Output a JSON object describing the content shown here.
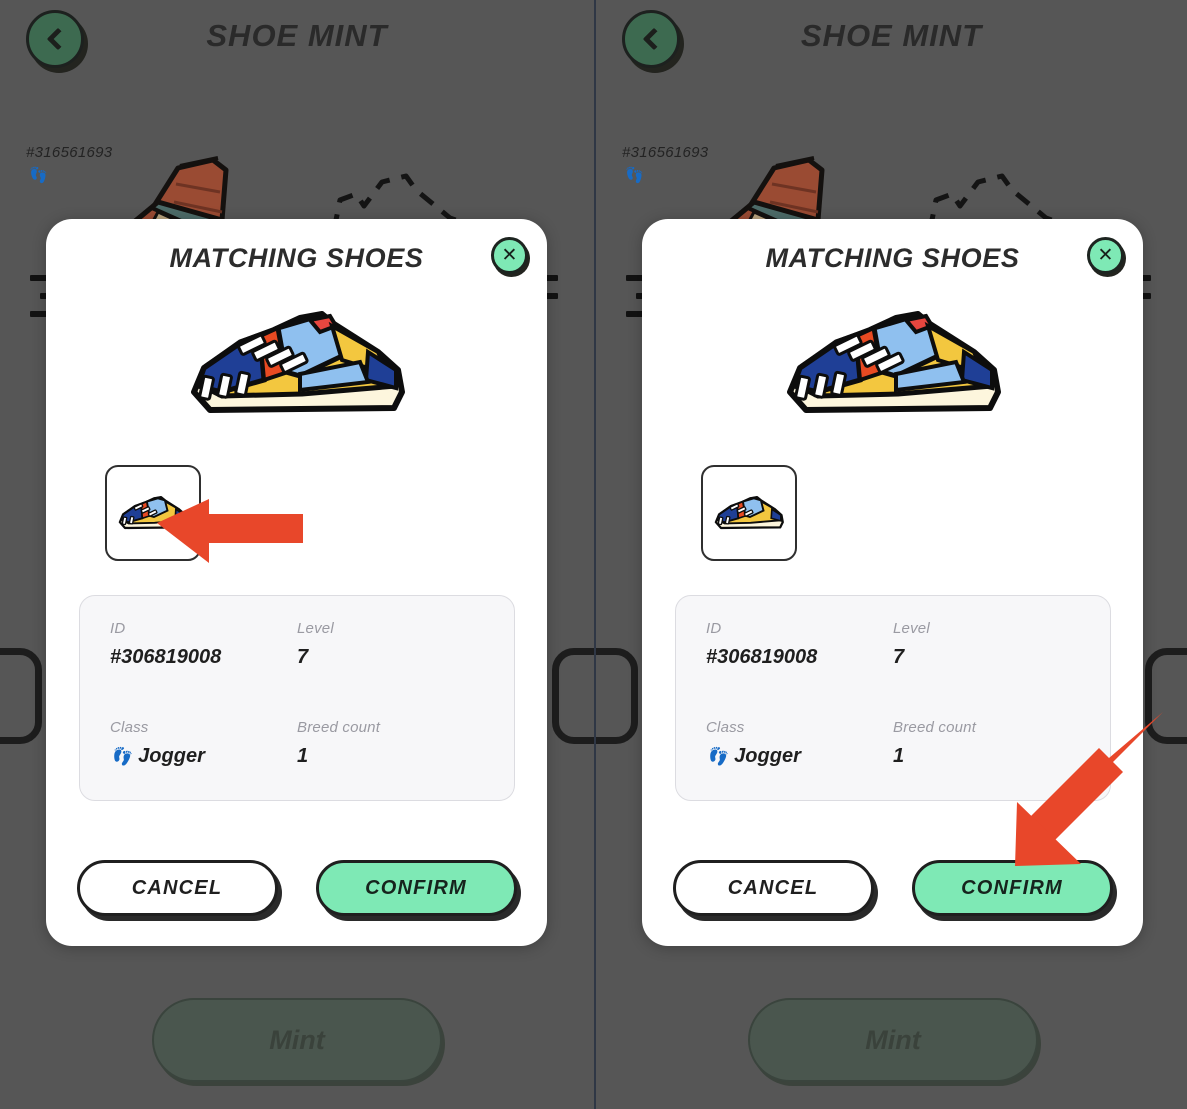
{
  "app": {
    "title": "SHOE MINT",
    "back_icon": "chevron-left-icon",
    "slot_id": "#316561693",
    "footprint_icon": "footprint-icon",
    "mint_button": "Mint"
  },
  "modal": {
    "title": "MATCHING SHOES",
    "close_icon": "close-icon",
    "close_label": "✕",
    "shoe_icon": "sneaker-icon",
    "thumbnail_icon": "sneaker-thumbnail-icon",
    "stats": {
      "id_label": "ID",
      "id_value": "#306819008",
      "level_label": "Level",
      "level_value": "7",
      "class_label": "Class",
      "class_icon": "footprints-icon",
      "class_glyph": "👣",
      "class_value": "Jogger",
      "breed_label": "Breed count",
      "breed_value": "1"
    },
    "cancel_label": "CANCEL",
    "confirm_label": "CONFIRM"
  },
  "annotations": [
    {
      "name": "arrow-to-thumbnail",
      "direction": "left",
      "target": "thumbnail"
    },
    {
      "name": "arrow-to-confirm",
      "direction": "down-left",
      "target": "confirm-button"
    }
  ],
  "colors": {
    "background": "#565656",
    "accent_mint": "#7ee9b5",
    "arrow_red": "#e8472a",
    "back_green": "#3d6a50",
    "panel_divider": "#2f3745",
    "ink": "#1f1f1f"
  }
}
